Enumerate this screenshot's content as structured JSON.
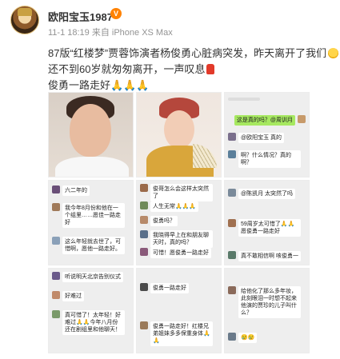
{
  "user": {
    "name": "欧阳宝玉1987",
    "meta": "11-1 18:19  来自 iPhone XS Max"
  },
  "post": {
    "line1": "87版“红楼梦”贾蓉饰演者杨俊勇心脏病突发，昨天离开了我们",
    "line2": "还不到60岁就匆匆离开，一声叹息",
    "line3": "俊勇一路走好🙏🙏🙏"
  },
  "chat3": {
    "m1": "这是真的吗？@周训月",
    "m2": "@欧阳宝玉 真的",
    "m3": "啊？什么情况？真的啊？"
  },
  "chat4": {
    "m1": "六二年的",
    "m2": "我今年8月份和他在一个组里……愿佳一路走好",
    "m3": "这么年轻就去世了，可惜啊，愿他一路走好。"
  },
  "chat5": {
    "m1": "俊哥怎么会这样太突然了",
    "m2": "人生无常🙏🙏🙏",
    "m3": "俊勇吗？",
    "m4": "我晓得早上在和朋友聊天时，真的吗？",
    "m5": "可惜！愿俊勇一路走好",
    "m6": "😢😢"
  },
  "chat6": {
    "m1": "@陈凯月 太突然了吗",
    "m2": "59周岁太可惜了🙏🙏愿俊勇一路走好",
    "m3": "真不敢相信啊 咳俊勇一"
  },
  "chat7": {
    "m1": "听说明天北京告别仪式",
    "m2": "好难过",
    "m3": "真可惜了！太年轻！好难过🙏🙏今年八月份还在剧组里和他聊天！"
  },
  "chat8": {
    "m1": "俊勇一路走好",
    "m2": "俊勇一路走好！红楼兄弟姐妹多多保重身体🙏🙏"
  },
  "chat9": {
    "m1": "给他化了那么多年妆，此刻眼泪一时想不起来他演的贾珍的儿子叫什么？",
    "m2": "😢😢"
  }
}
